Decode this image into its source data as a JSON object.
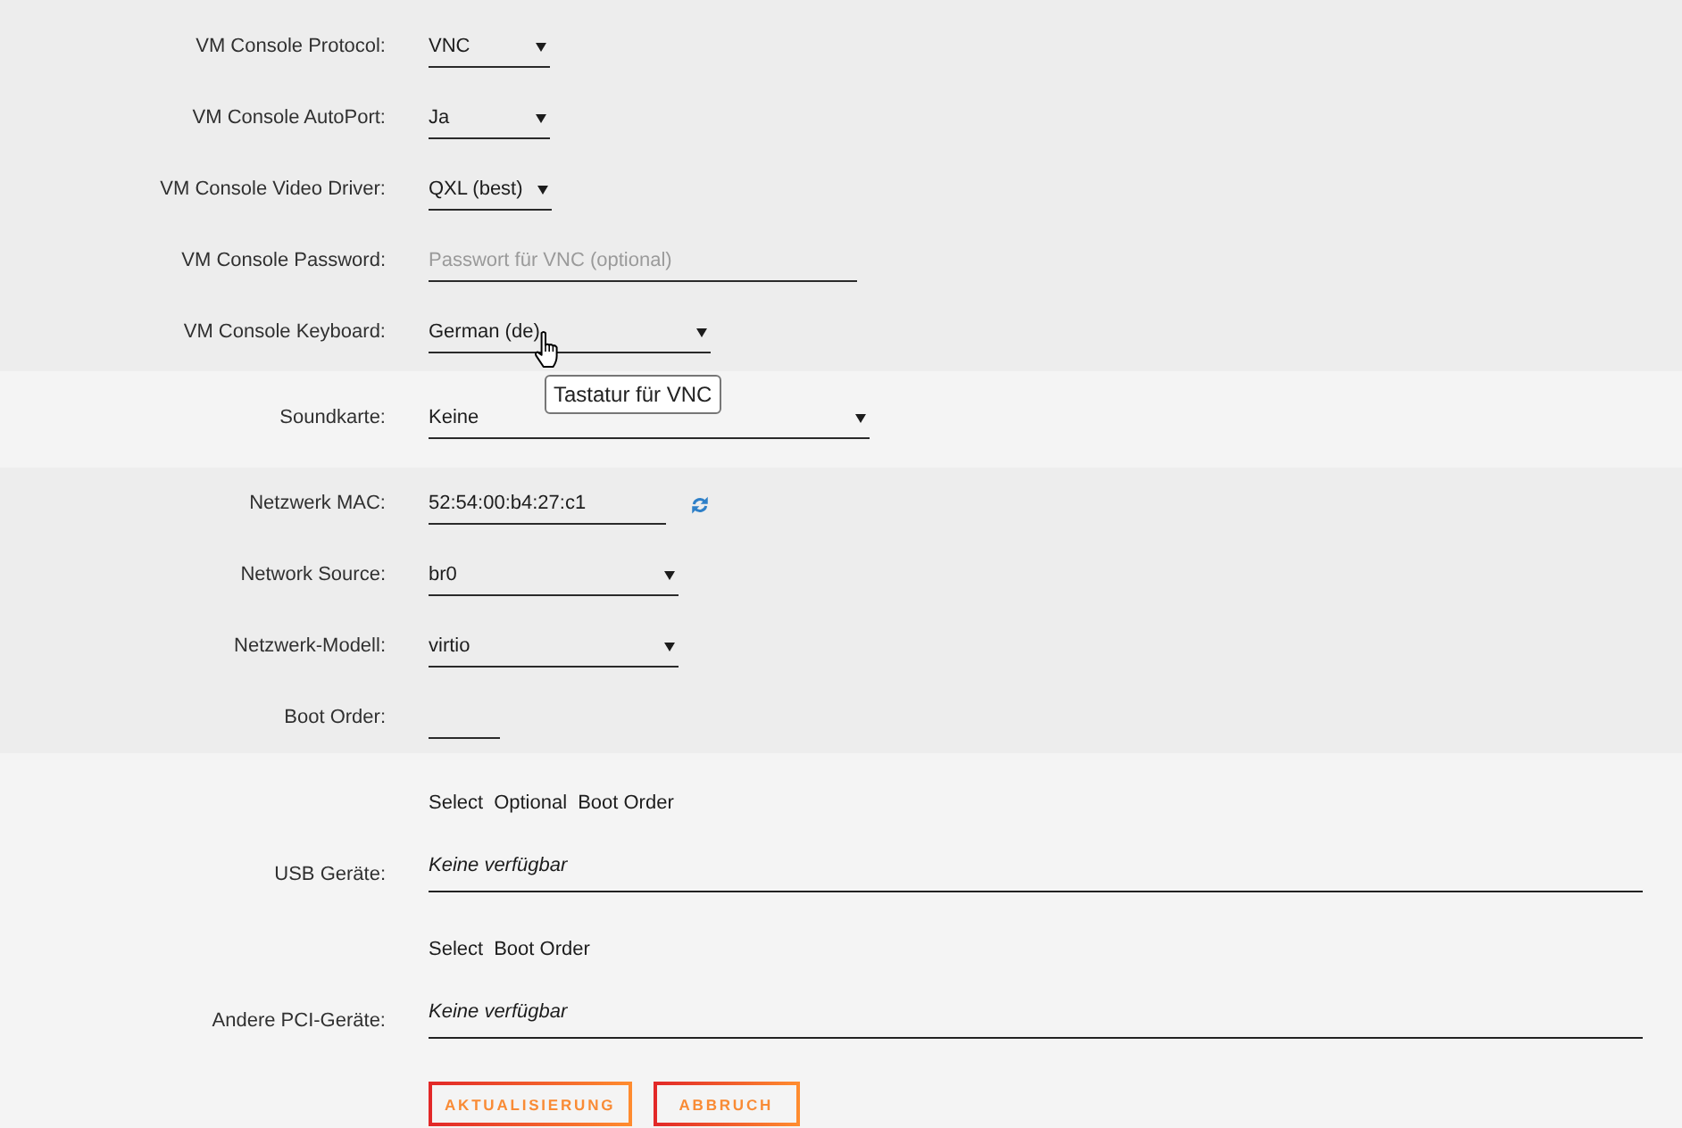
{
  "sections": [
    {
      "rows": [
        {
          "kind": "select",
          "label": "VM Console Protocol:",
          "value": "VNC"
        },
        {
          "kind": "select",
          "label": "VM Console AutoPort:",
          "value": "Ja"
        },
        {
          "kind": "select",
          "label": "VM Console Video Driver:",
          "value": "QXL (best)"
        },
        {
          "kind": "input",
          "label": "VM Console Password:",
          "placeholder": "Passwort für VNC (optional)"
        },
        {
          "kind": "select",
          "label": "VM Console Keyboard:",
          "value": "German (de)",
          "hovered": true,
          "tooltip": "Tastatur für VNC"
        }
      ]
    },
    {
      "rows": [
        {
          "kind": "select",
          "label": "Soundkarte:",
          "value": "Keine"
        }
      ]
    },
    {
      "rows": [
        {
          "kind": "refresh",
          "label": "Netzwerk MAC:",
          "value": "52:54:00:b4:27:c1"
        },
        {
          "kind": "select",
          "label": "Network Source:",
          "value": "br0"
        },
        {
          "kind": "select",
          "label": "Netzwerk-Modell:",
          "value": "virtio"
        },
        {
          "kind": "input",
          "label": "Boot Order:"
        }
      ]
    },
    {
      "devices": [
        {
          "label": "USB Geräte:",
          "columns": [
            "Select",
            "Optional",
            "Boot Order"
          ],
          "value": "Keine verfügbar"
        },
        {
          "label": "Andere PCI-Geräte:",
          "columns": [
            "Select",
            "Boot Order"
          ],
          "value": "Keine verfügbar"
        }
      ],
      "buttons": [
        "AKTUALISIERUNG",
        "ABBRUCH"
      ]
    }
  ]
}
